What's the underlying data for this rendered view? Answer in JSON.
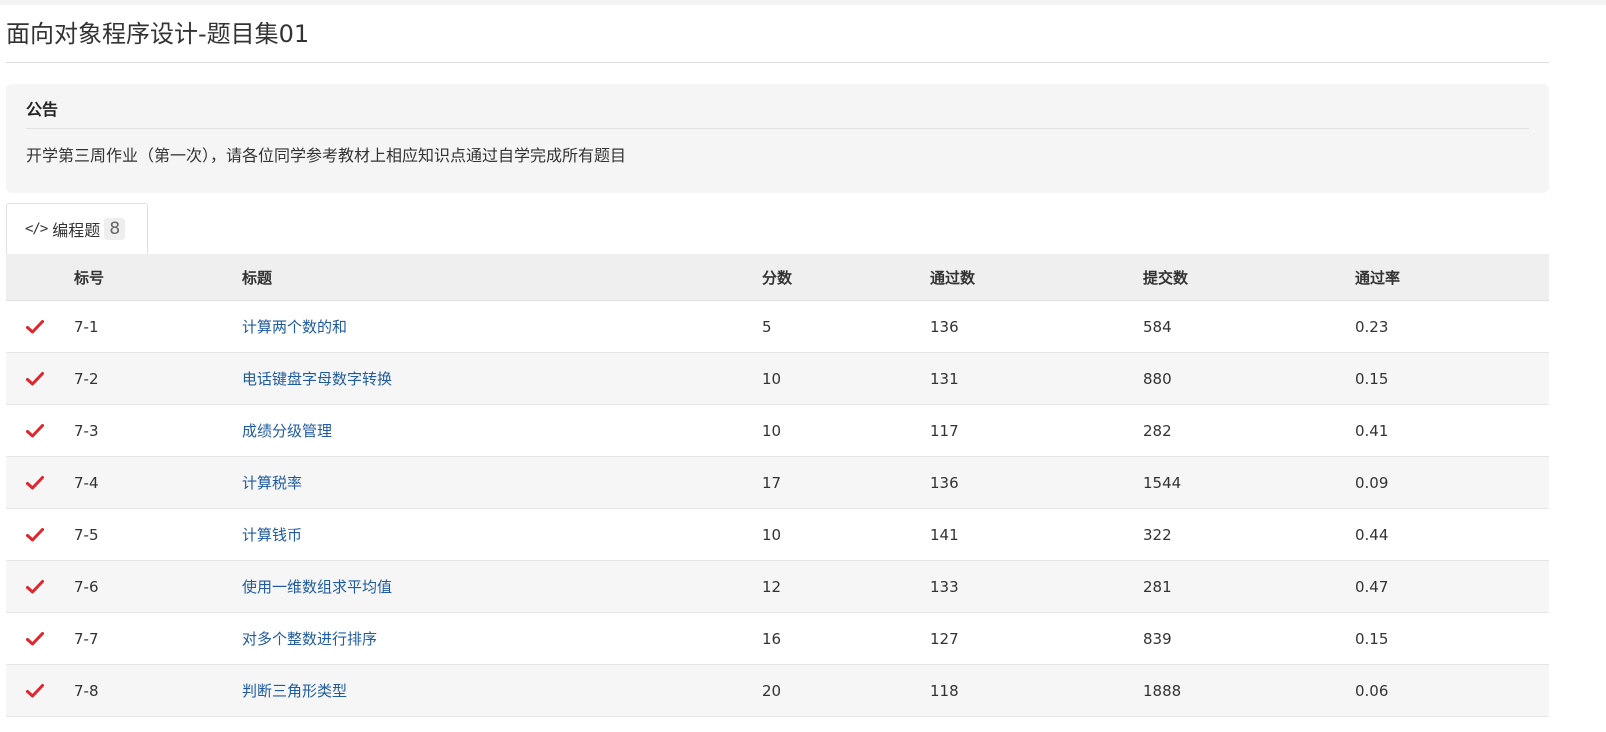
{
  "page": {
    "title": "面向对象程序设计-题目集01"
  },
  "notice": {
    "heading": "公告",
    "text": "开学第三周作业（第一次），请各位同学参考教材上相应知识点通过自学完成所有题目"
  },
  "tabs": [
    {
      "icon": "code-icon",
      "icon_glyph": "</>",
      "label": "编程题",
      "count": "8"
    }
  ],
  "table": {
    "headers": {
      "num": "标号",
      "title": "标题",
      "score": "分数",
      "pass": "通过数",
      "submit": "提交数",
      "rate": "通过率"
    },
    "rows": [
      {
        "solved": true,
        "num": "7-1",
        "title": "计算两个数的和",
        "score": "5",
        "pass": "136",
        "submit": "584",
        "rate": "0.23"
      },
      {
        "solved": true,
        "num": "7-2",
        "title": "电话键盘字母数字转换",
        "score": "10",
        "pass": "131",
        "submit": "880",
        "rate": "0.15"
      },
      {
        "solved": true,
        "num": "7-3",
        "title": "成绩分级管理",
        "score": "10",
        "pass": "117",
        "submit": "282",
        "rate": "0.41"
      },
      {
        "solved": true,
        "num": "7-4",
        "title": "计算税率",
        "score": "17",
        "pass": "136",
        "submit": "1544",
        "rate": "0.09"
      },
      {
        "solved": true,
        "num": "7-5",
        "title": "计算钱币",
        "score": "10",
        "pass": "141",
        "submit": "322",
        "rate": "0.44"
      },
      {
        "solved": true,
        "num": "7-6",
        "title": "使用一维数组求平均值",
        "score": "12",
        "pass": "133",
        "submit": "281",
        "rate": "0.47"
      },
      {
        "solved": true,
        "num": "7-7",
        "title": "对多个整数进行排序",
        "score": "16",
        "pass": "127",
        "submit": "839",
        "rate": "0.15"
      },
      {
        "solved": true,
        "num": "7-8",
        "title": "判断三角形类型",
        "score": "20",
        "pass": "118",
        "submit": "1888",
        "rate": "0.06"
      }
    ]
  },
  "colors": {
    "check": "#e0262c",
    "link": "#1f5b9e",
    "header_bg": "#efefef",
    "stripe_bg": "#f6f6f6",
    "notice_bg": "#f5f5f5"
  }
}
